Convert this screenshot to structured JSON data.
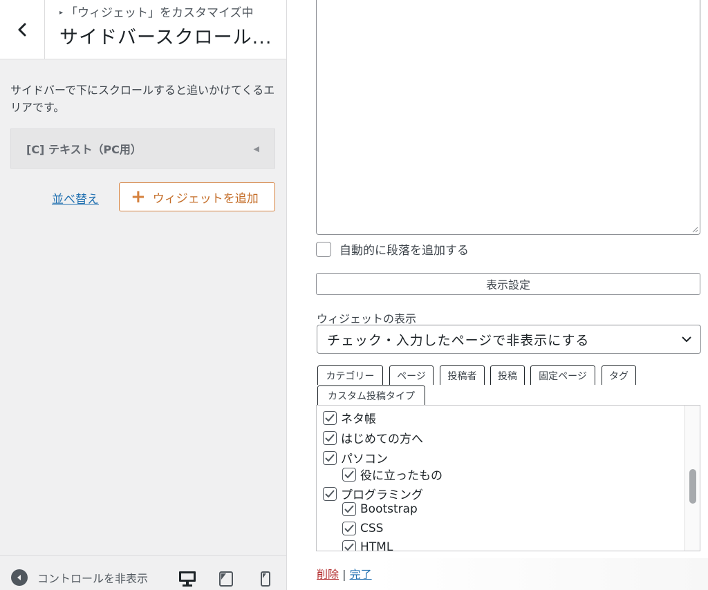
{
  "panel": {
    "breadcrumb": "「ウィジェット」をカスタマイズ中",
    "title": "サイドバースクロール...",
    "description": "サイドバーで下にスクロールすると追いかけてくるエリアです。",
    "widget": {
      "title": "[C] テキスト（PC用）"
    },
    "reorder_label": "並べ替え",
    "add_widget_label": "ウィジェットを追加",
    "footer": {
      "collapse_label": "コントロールを非表示"
    }
  },
  "form": {
    "autop_label": "自動的に段落を追加する",
    "autop_checked": false,
    "display_settings_label": "表示設定",
    "visibility_label": "ウィジェットの表示",
    "visibility_value": "チェック・入力したページで非表示にする",
    "tabs": [
      "カテゴリー",
      "ページ",
      "投稿者",
      "投稿",
      "固定ページ",
      "タグ",
      "カスタム投稿タイプ"
    ],
    "tree": [
      {
        "label": "ネタ帳",
        "checked": true,
        "level": 0
      },
      {
        "label": "はじめての方へ",
        "checked": true,
        "level": 0
      },
      {
        "label": "パソコン",
        "checked": true,
        "level": 0
      },
      {
        "label": "役に立ったもの",
        "checked": true,
        "level": 1
      },
      {
        "label": "プログラミング",
        "checked": true,
        "level": 0
      },
      {
        "label": "Bootstrap",
        "checked": true,
        "level": 1
      },
      {
        "label": "CSS",
        "checked": true,
        "level": 1
      },
      {
        "label": "HTML",
        "checked": true,
        "level": 1
      }
    ],
    "delete_label": "削除",
    "separator": "|",
    "done_label": "完了"
  },
  "colors": {
    "accent": "#d5813e",
    "link": "#2271b1",
    "delete": "#b32d2e",
    "panel_bg": "#f0f0f1"
  }
}
